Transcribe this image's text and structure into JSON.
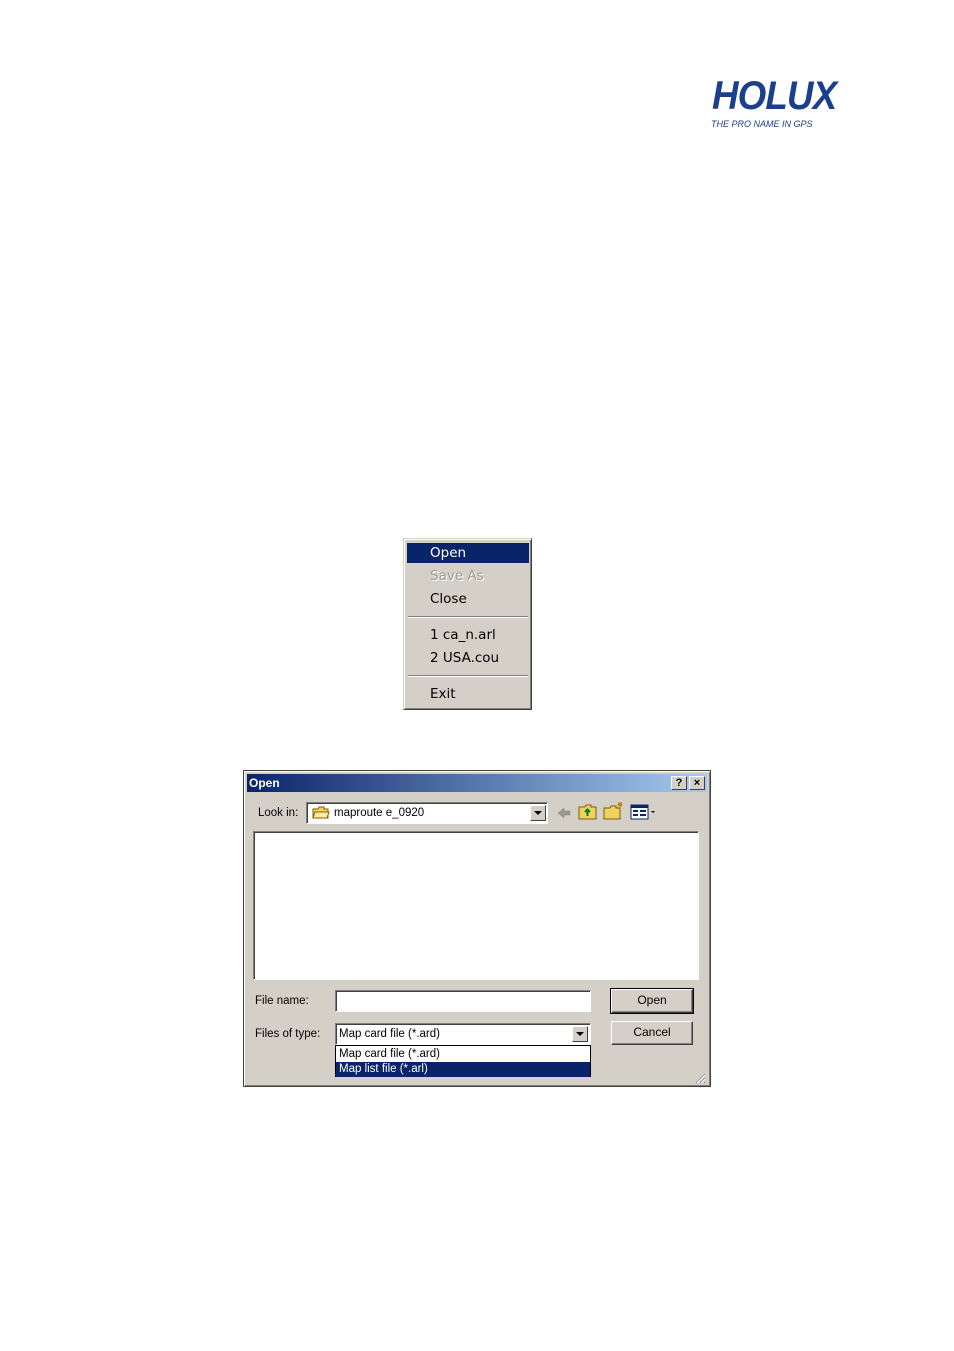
{
  "logo": {
    "brand": "HOLUX",
    "tagline": "THE PRO NAME IN GPS"
  },
  "context_menu": {
    "items": [
      {
        "label": "Open",
        "state": "highlighted"
      },
      {
        "label": "Save As",
        "state": "disabled"
      },
      {
        "label": "Close",
        "state": "normal"
      },
      {
        "label": "1 ca_n.arl",
        "state": "normal"
      },
      {
        "label": "2 USA.cou",
        "state": "normal"
      },
      {
        "label": "Exit",
        "state": "normal"
      }
    ]
  },
  "open_dialog": {
    "title": "Open",
    "help_button": "?",
    "close_button": "×",
    "look_in_label": "Look in:",
    "look_in_value": "maproute e_0920",
    "file_name_label": "File name:",
    "file_name_value": "",
    "files_of_type_label": "Files of type:",
    "files_of_type_value": "Map card file (*.ard)",
    "files_of_type_options": [
      {
        "label": "Map card file (*.ard)",
        "selected": false
      },
      {
        "label": "Map list file (*.arl)",
        "selected": true
      }
    ],
    "open_button": "Open",
    "cancel_button": "Cancel",
    "toolbar_icons": [
      "back-arrow-icon",
      "up-folder-icon",
      "new-folder-icon",
      "view-menu-icon"
    ]
  },
  "colors": {
    "highlight": "#0a246a",
    "face": "#d4d0c8",
    "brand": "#1b3f8c"
  }
}
